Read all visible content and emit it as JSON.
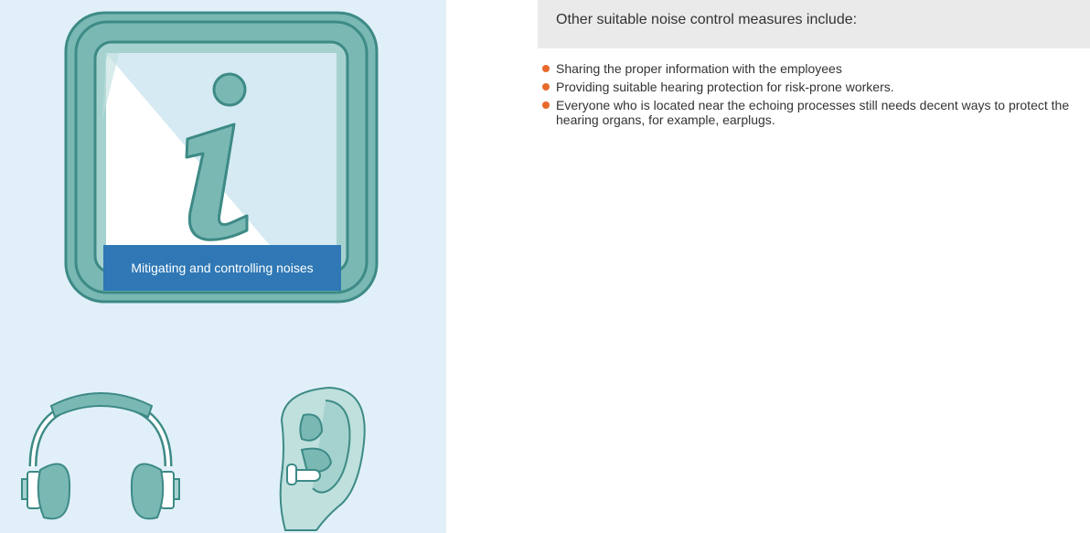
{
  "info_card": {
    "label": "Mitigating and controlling noises",
    "icon": "info-icon"
  },
  "illustrations": [
    "headphones-icon",
    "ear-with-earplug-icon"
  ],
  "content": {
    "heading": "Other suitable noise control measures include:",
    "bullets": [
      "Sharing the proper information with the employees",
      "Providing suitable hearing protection for risk-prone workers.",
      "Everyone who is located near the echoing processes still needs decent ways to protect the hearing organs, for example, earplugs."
    ]
  },
  "colors": {
    "panel_bg": "#e1f0f8",
    "teal": "#7ab8b4",
    "teal_dark": "#3d8a86",
    "label_bg": "#2f78b5",
    "bullet": "#e8692a",
    "heading_bg": "#eaeaea"
  }
}
